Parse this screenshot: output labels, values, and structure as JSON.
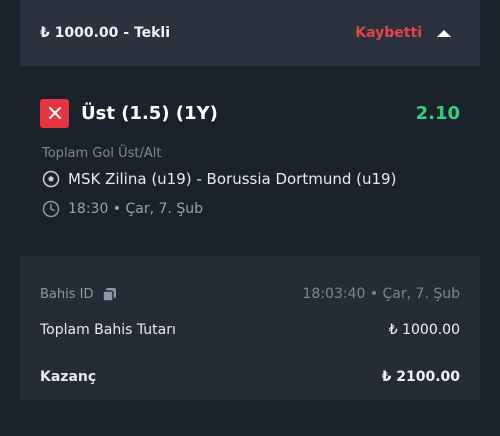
{
  "header": {
    "title": "₺ 1000.00 - Tekli",
    "status": "Kaybetti",
    "status_color": "#e3434a",
    "toggle_icon": "chevron-up-icon"
  },
  "bet": {
    "status_icon": "close-icon",
    "name": "Üst (1.5) (1Y)",
    "odds": "2.10",
    "odds_color": "#2fd37a",
    "market": "Toplam Gol Üst/Alt",
    "match_icon": "soccer-ball-icon",
    "match": "MSK Zilina (u19) - Borussia Dortmund (u19)",
    "time_icon": "clock-icon",
    "time": "18:30 • Çar, 7. Şub"
  },
  "summary": {
    "bet_id_label": "Bahis ID",
    "copy_icon": "copy-icon",
    "placed_at": "18:03:40 • Çar, 7. Şub",
    "total_stake_label": "Toplam Bahis Tutarı",
    "total_stake": "₺ 1000.00",
    "winnings_label": "Kazanç",
    "winnings": "₺ 2100.00"
  }
}
